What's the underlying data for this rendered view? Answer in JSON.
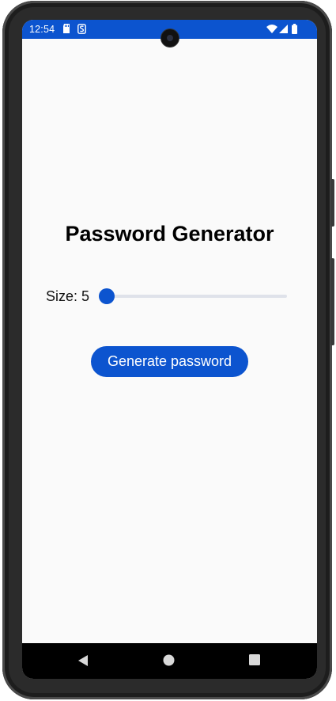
{
  "status_bar": {
    "time": "12:54",
    "icons": [
      "sd-card-icon",
      "s-notification-icon",
      "wifi-icon",
      "signal-icon",
      "battery-icon"
    ],
    "background": "#0c54cf"
  },
  "app": {
    "title": "Password Generator",
    "size_label": "Size: 5",
    "slider": {
      "value": 5,
      "min": 5,
      "max": 30,
      "fraction": 0.0
    },
    "generate_button_label": "Generate password",
    "accent_color": "#0c54cf"
  },
  "nav_bar": {
    "buttons": [
      "back-icon",
      "home-icon",
      "recents-icon"
    ]
  }
}
